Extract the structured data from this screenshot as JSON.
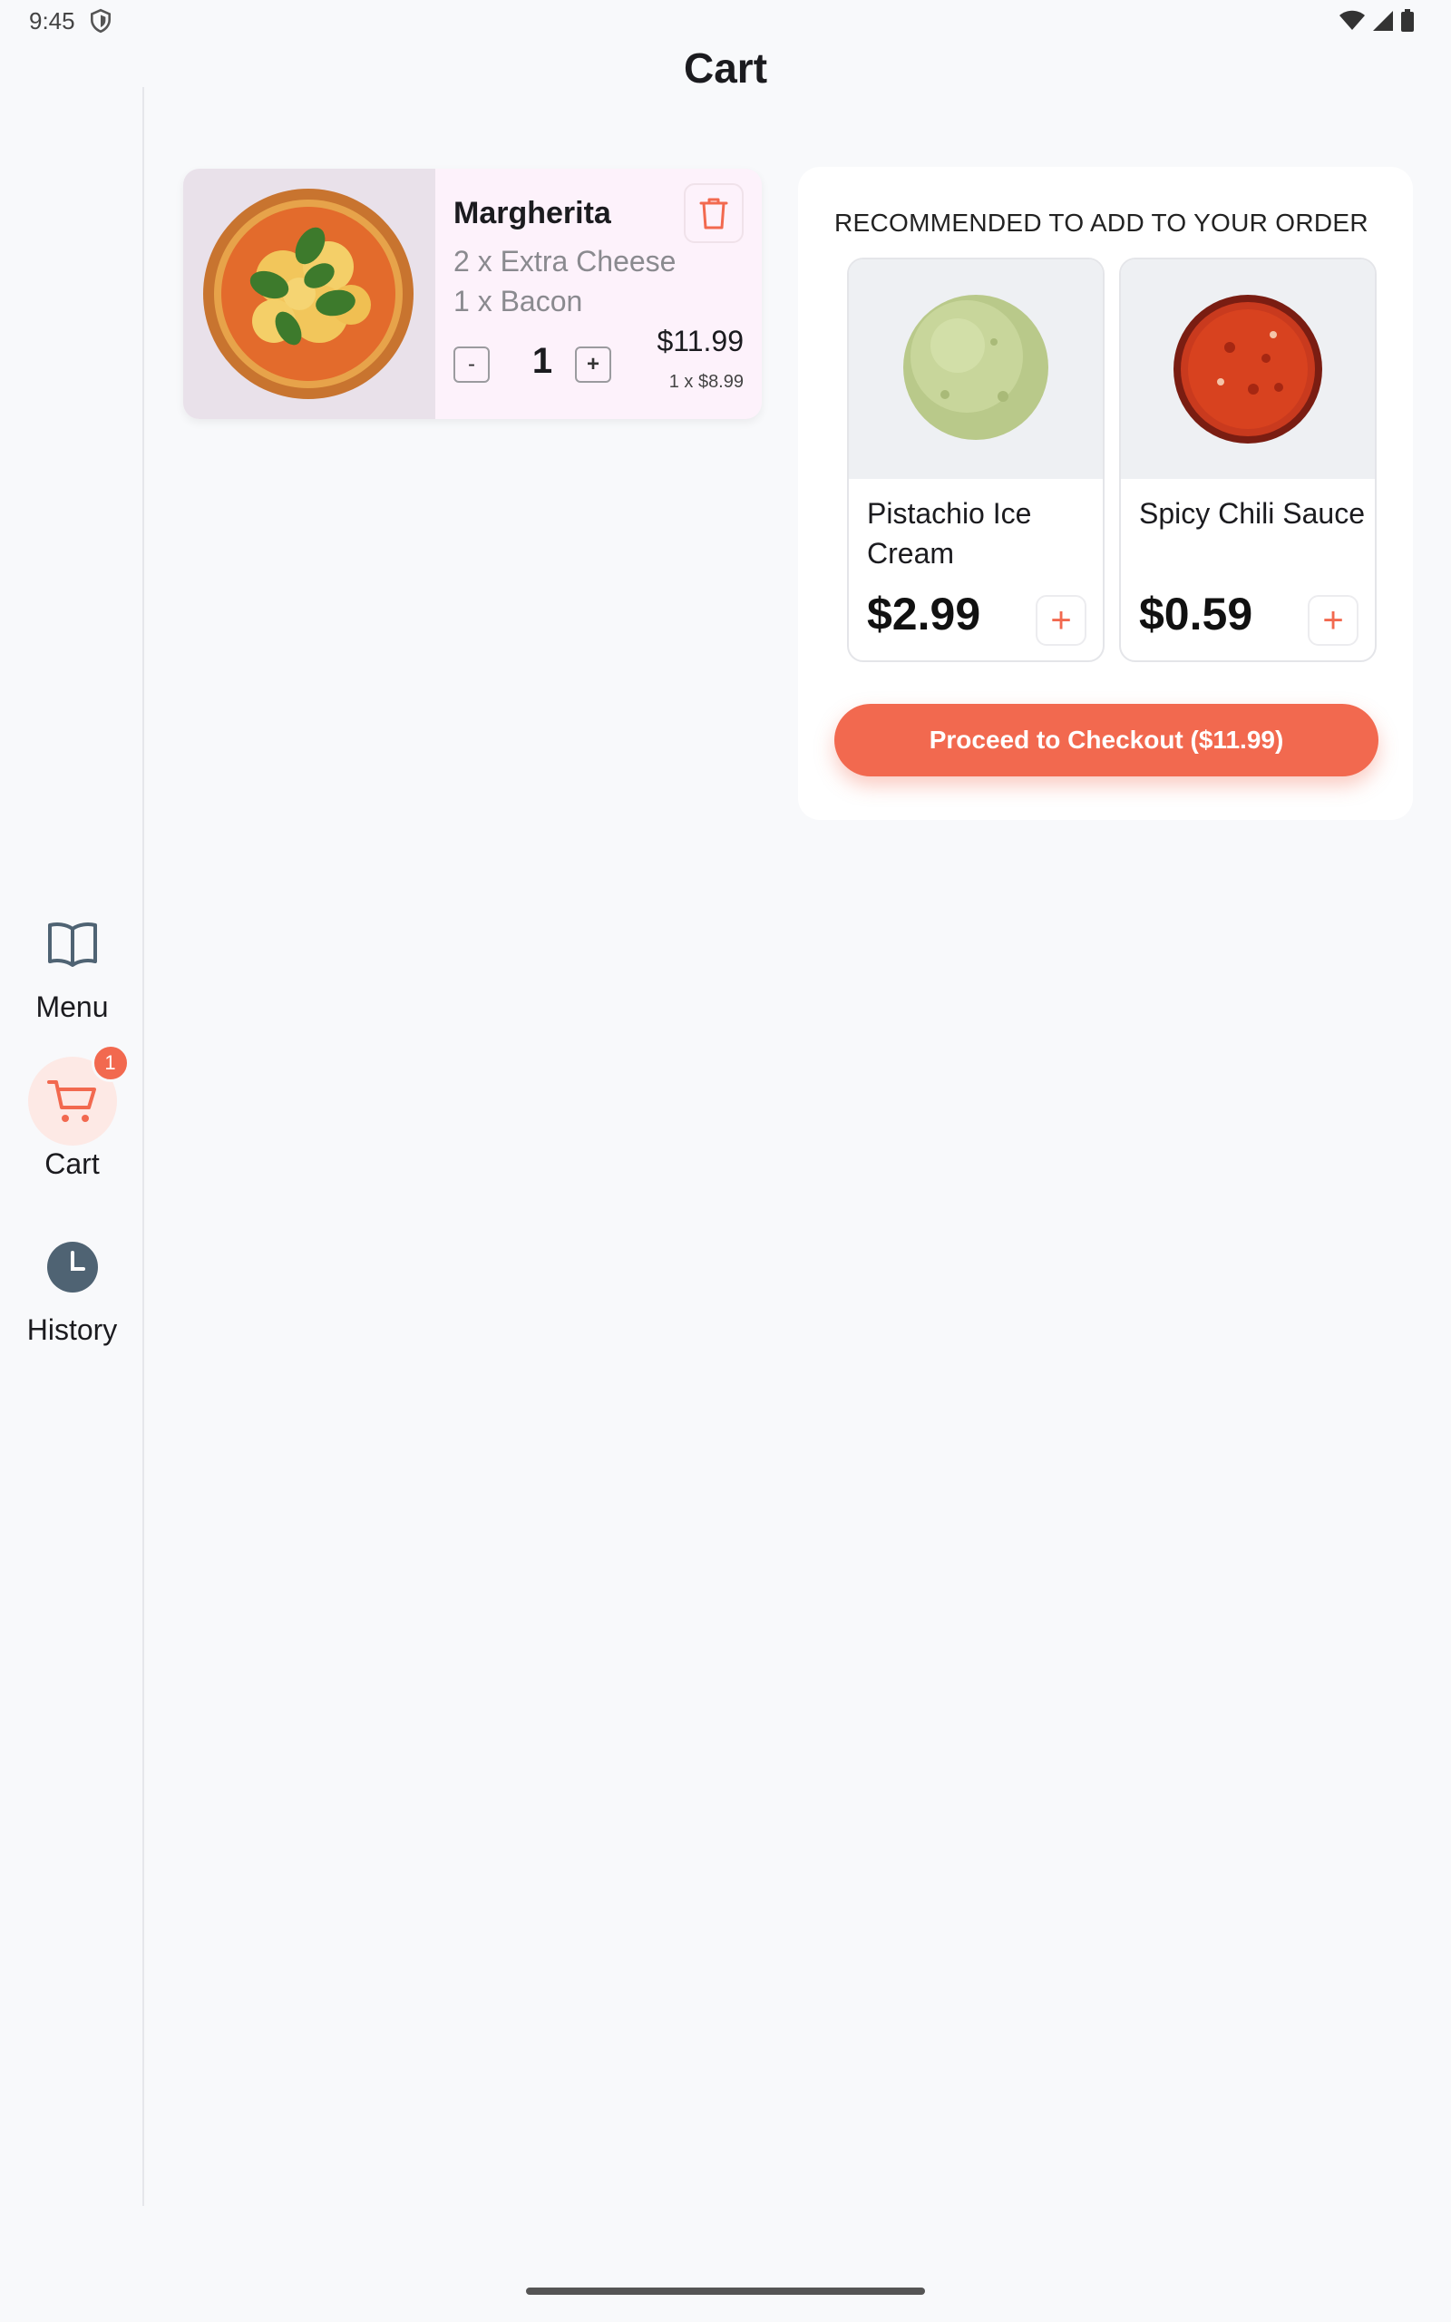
{
  "status_bar": {
    "time": "9:45"
  },
  "header": {
    "title": "Cart"
  },
  "nav_rail": {
    "items": [
      {
        "label": "Menu",
        "icon": "book-open-icon"
      },
      {
        "label": "Cart",
        "icon": "cart-icon",
        "badge": "1",
        "active": true
      },
      {
        "label": "History",
        "icon": "clock-icon"
      }
    ]
  },
  "cart": {
    "items": [
      {
        "name": "Margherita",
        "modifiers": [
          "2 x Extra Cheese",
          "1 x Bacon"
        ],
        "quantity": "1",
        "total": "$11.99",
        "unit_price": "1 x $8.99",
        "decrease_label": "-",
        "increase_label": "+"
      }
    ]
  },
  "recommendations": {
    "title": "RECOMMENDED TO ADD TO YOUR ORDER",
    "items": [
      {
        "name": "Pistachio Ice Cream",
        "price": "$2.99",
        "add_label": "+"
      },
      {
        "name": "Spicy Chili Sauce",
        "price": "$0.59",
        "add_label": "+"
      }
    ]
  },
  "checkout": {
    "label": "Proceed to Checkout ($11.99)"
  },
  "colors": {
    "accent": "#f2694f",
    "badge": "#f2694f",
    "card_bg": "#fdf2fb"
  }
}
